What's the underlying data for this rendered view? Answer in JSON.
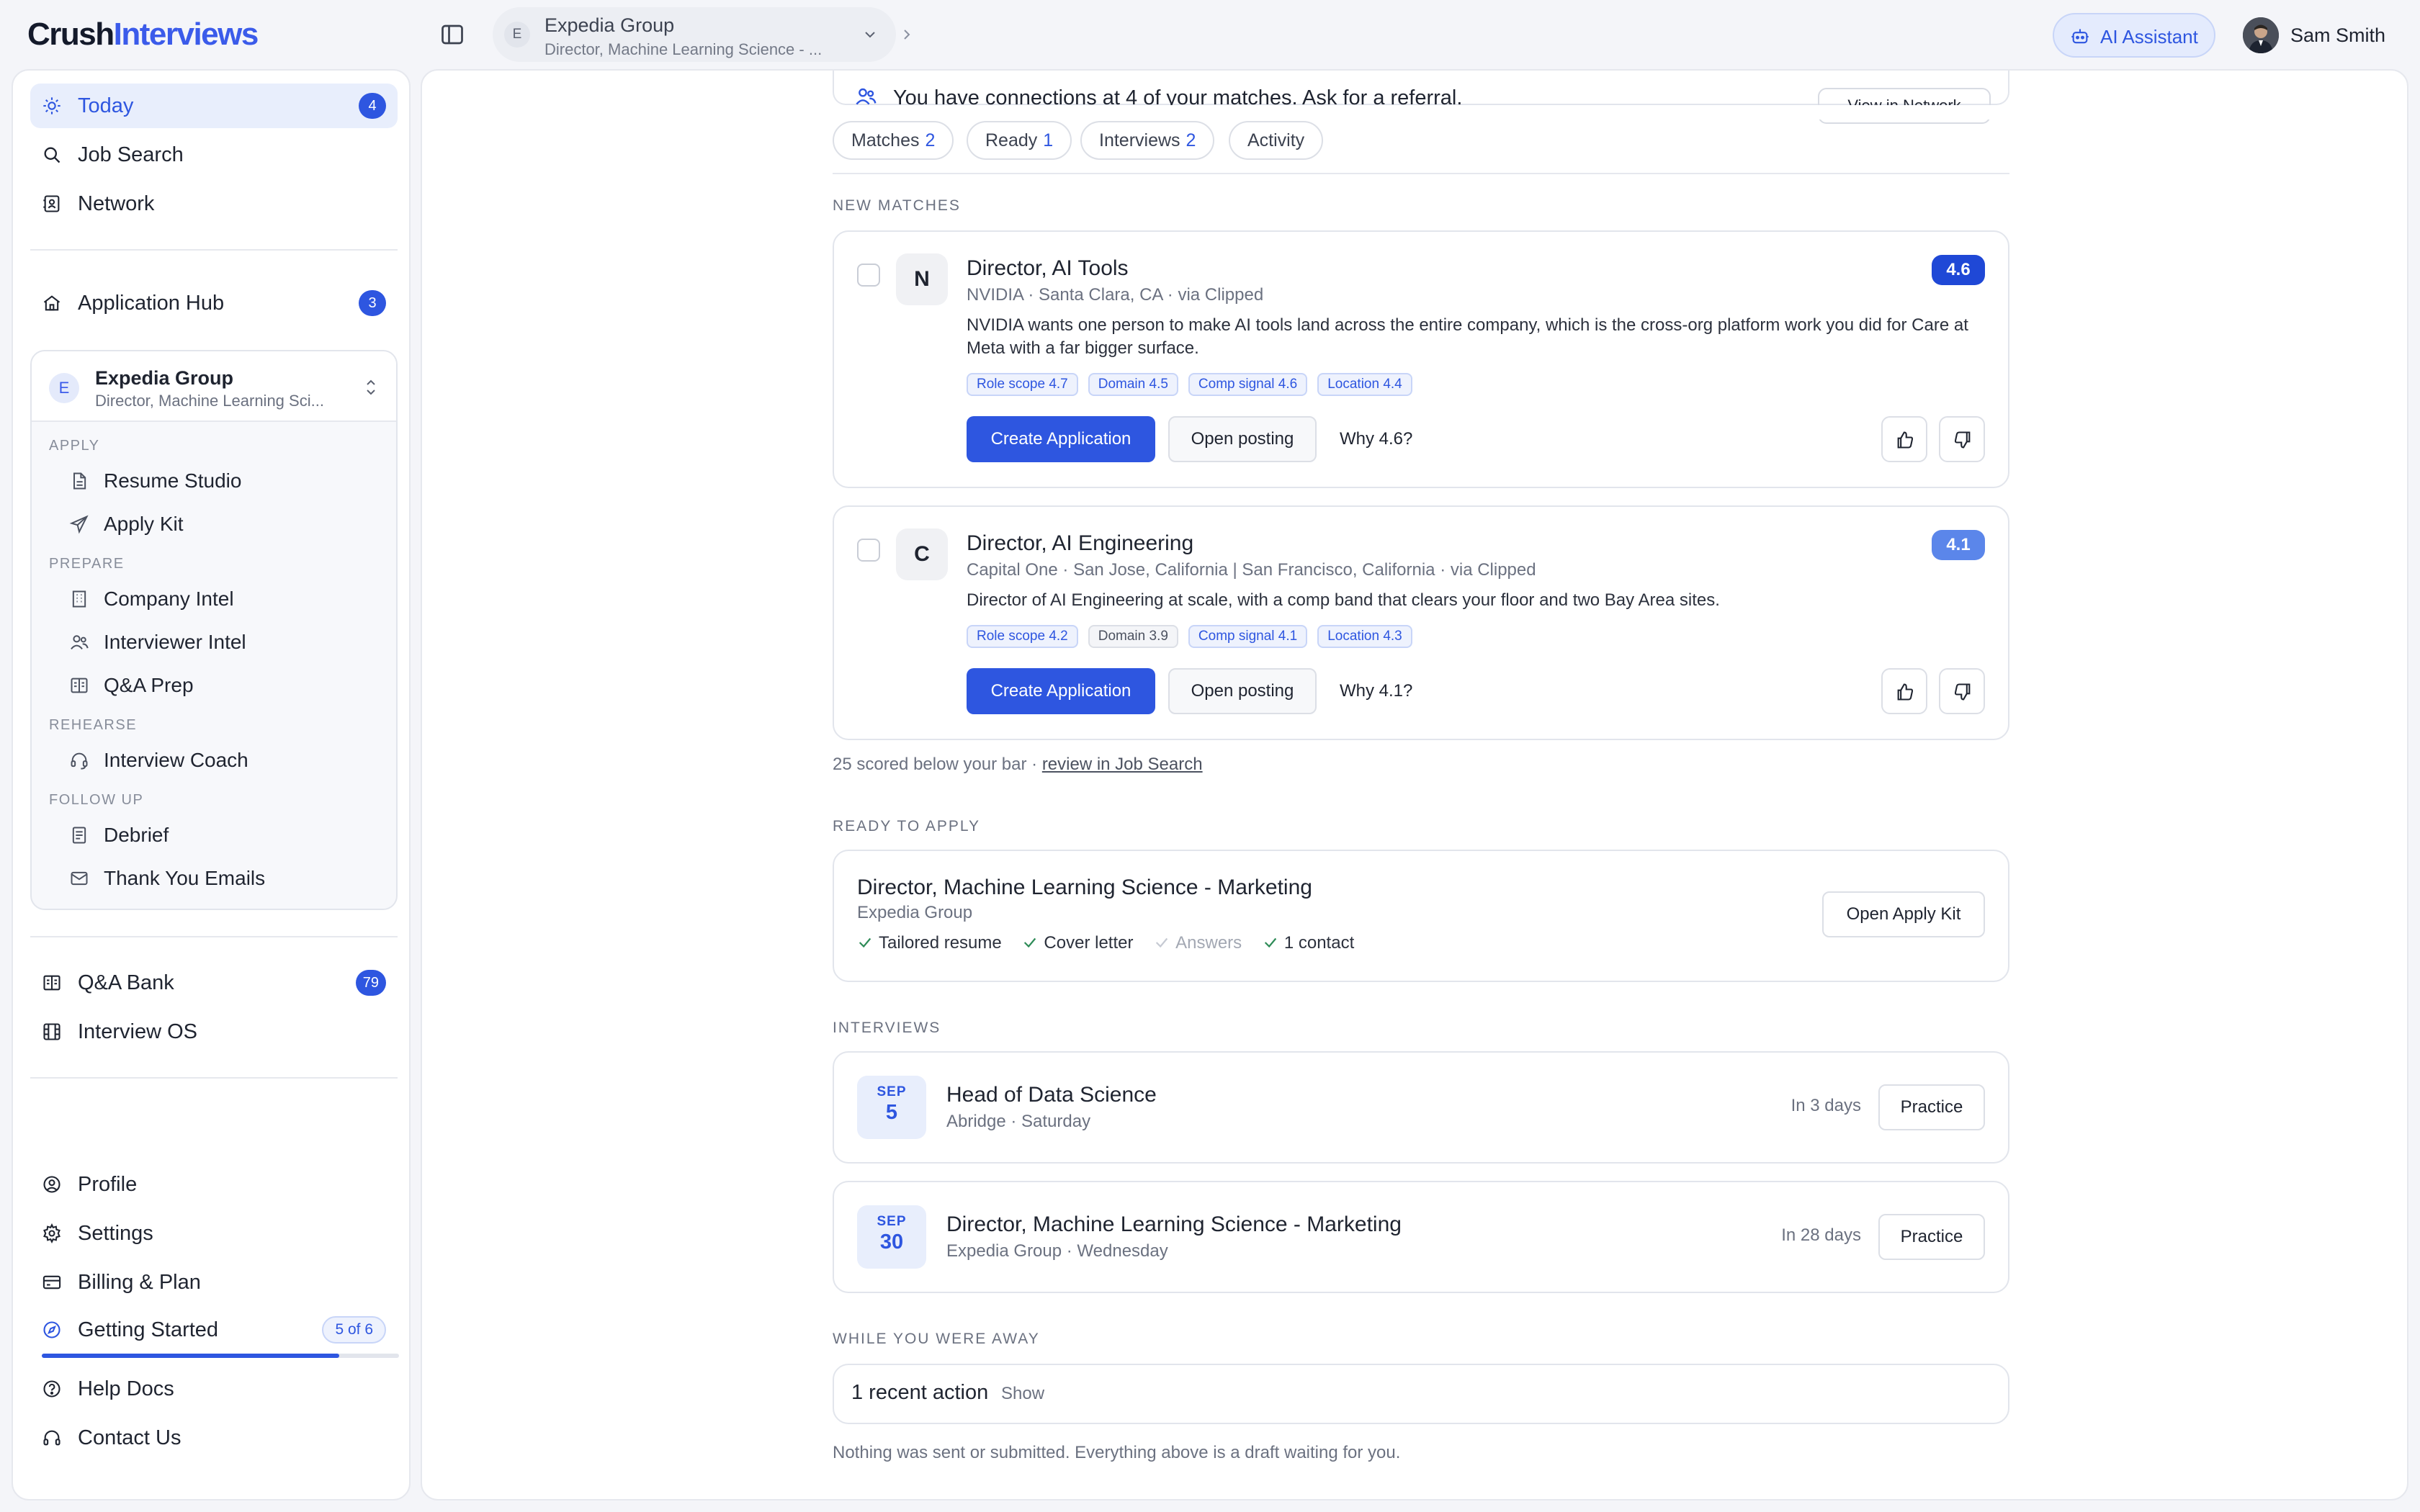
{
  "brand": {
    "part1": "Crush",
    "part2": "Interviews"
  },
  "header": {
    "context": {
      "avatar_letter": "E",
      "company": "Expedia Group",
      "role": "Director, Machine Learning Science - ..."
    },
    "ai_assistant_label": "AI Assistant",
    "user_name": "Sam Smith"
  },
  "sidebar": {
    "top_items": [
      {
        "label": "Today",
        "badge": "4",
        "icon": "sun-icon"
      },
      {
        "label": "Job Search",
        "icon": "search-icon"
      },
      {
        "label": "Network",
        "icon": "contacts-icon"
      }
    ],
    "app_hub": {
      "label": "Application Hub",
      "badge": "3",
      "icon": "home-icon"
    },
    "application": {
      "avatar_letter": "E",
      "company": "Expedia Group",
      "role": "Director, Machine Learning Sci...",
      "sections": [
        {
          "label": "APPLY",
          "items": [
            {
              "label": "Resume Studio",
              "icon": "document-icon"
            },
            {
              "label": "Apply Kit",
              "icon": "send-icon"
            }
          ]
        },
        {
          "label": "PREPARE",
          "items": [
            {
              "label": "Company Intel",
              "icon": "building-icon"
            },
            {
              "label": "Interviewer Intel",
              "icon": "people-icon"
            },
            {
              "label": "Q&A Prep",
              "icon": "book-icon"
            }
          ]
        },
        {
          "label": "REHEARSE",
          "items": [
            {
              "label": "Interview Coach",
              "icon": "headset-icon"
            }
          ]
        },
        {
          "label": "FOLLOW UP",
          "items": [
            {
              "label": "Debrief",
              "icon": "notes-icon"
            },
            {
              "label": "Thank You Emails",
              "icon": "mail-icon"
            }
          ]
        }
      ]
    },
    "qa_bank": {
      "label": "Q&A Bank",
      "badge": "79",
      "icon": "book-icon"
    },
    "interview_os": {
      "label": "Interview OS",
      "icon": "film-icon"
    },
    "bottom_items": [
      {
        "label": "Profile",
        "icon": "user-circle-icon"
      },
      {
        "label": "Settings",
        "icon": "gear-icon"
      },
      {
        "label": "Billing & Plan",
        "icon": "card-icon"
      }
    ],
    "getting_started": {
      "label": "Getting Started",
      "progress_label": "5 of 6",
      "progress": 0.833
    },
    "help_items": [
      {
        "label": "Help Docs",
        "icon": "help-icon"
      },
      {
        "label": "Contact Us",
        "icon": "headphones-icon"
      }
    ]
  },
  "main": {
    "connections_banner": {
      "text": "You have connections at 4 of your matches. Ask for a referral.",
      "button": "View in Network"
    },
    "tabs": [
      {
        "label": "Matches",
        "count": "2"
      },
      {
        "label": "Ready",
        "count": "1"
      },
      {
        "label": "Interviews",
        "count": "2"
      },
      {
        "label": "Activity",
        "count": ""
      }
    ],
    "new_matches": {
      "title": "NEW MATCHES",
      "items": [
        {
          "letter": "N",
          "title": "Director, AI Tools",
          "meta": "NVIDIA · Santa Clara, CA · via Clipped",
          "score": "4.6",
          "score_color": "#1f48d6",
          "description": "NVIDIA wants one person to make AI tools land across the entire company, which is the cross-org platform work you did for Care at Meta with a far bigger surface.",
          "chips": [
            {
              "label": "Role scope 4.7",
              "style": "blue"
            },
            {
              "label": "Domain 4.5",
              "style": "blue"
            },
            {
              "label": "Comp signal 4.6",
              "style": "blue"
            },
            {
              "label": "Location 4.4",
              "style": "blue"
            }
          ],
          "create_label": "Create Application",
          "open_label": "Open posting",
          "why_label": "Why 4.6?"
        },
        {
          "letter": "C",
          "title": "Director, AI Engineering",
          "meta": "Capital One · San Jose, California | San Francisco, California · via Clipped",
          "score": "4.1",
          "score_color": "#5b86ea",
          "description": "Director of AI Engineering at scale, with a comp band that clears your floor and two Bay Area sites.",
          "chips": [
            {
              "label": "Role scope 4.2",
              "style": "blue"
            },
            {
              "label": "Domain 3.9",
              "style": "neutral"
            },
            {
              "label": "Comp signal 4.1",
              "style": "blue"
            },
            {
              "label": "Location 4.3",
              "style": "blue"
            }
          ],
          "create_label": "Create Application",
          "open_label": "Open posting",
          "why_label": "Why 4.1?"
        }
      ],
      "below_bar_text": "25 scored below your bar · ",
      "below_bar_link": "review in Job Search"
    },
    "ready_to_apply": {
      "title": "READY TO APPLY",
      "job_title": "Director, Machine Learning Science - Marketing",
      "company": "Expedia Group",
      "checks": [
        {
          "label": "Tailored resume",
          "done": true
        },
        {
          "label": "Cover letter",
          "done": true
        },
        {
          "label": "Answers",
          "done": false
        },
        {
          "label": "1 contact",
          "done": true
        }
      ],
      "button": "Open Apply Kit"
    },
    "interviews": {
      "title": "INTERVIEWS",
      "items": [
        {
          "month": "SEP",
          "day": "5",
          "title": "Head of Data Science",
          "sub": "Abridge · Saturday",
          "when": "In 3 days",
          "button": "Practice"
        },
        {
          "month": "SEP",
          "day": "30",
          "title": "Director, Machine Learning Science - Marketing",
          "sub": "Expedia Group · Wednesday",
          "when": "In 28 days",
          "button": "Practice"
        }
      ]
    },
    "away": {
      "title": "WHILE YOU WERE AWAY",
      "summary": "1 recent action",
      "show_label": "Show",
      "footnote": "Nothing was sent or submitted. Everything above is a draft waiting for you."
    }
  }
}
